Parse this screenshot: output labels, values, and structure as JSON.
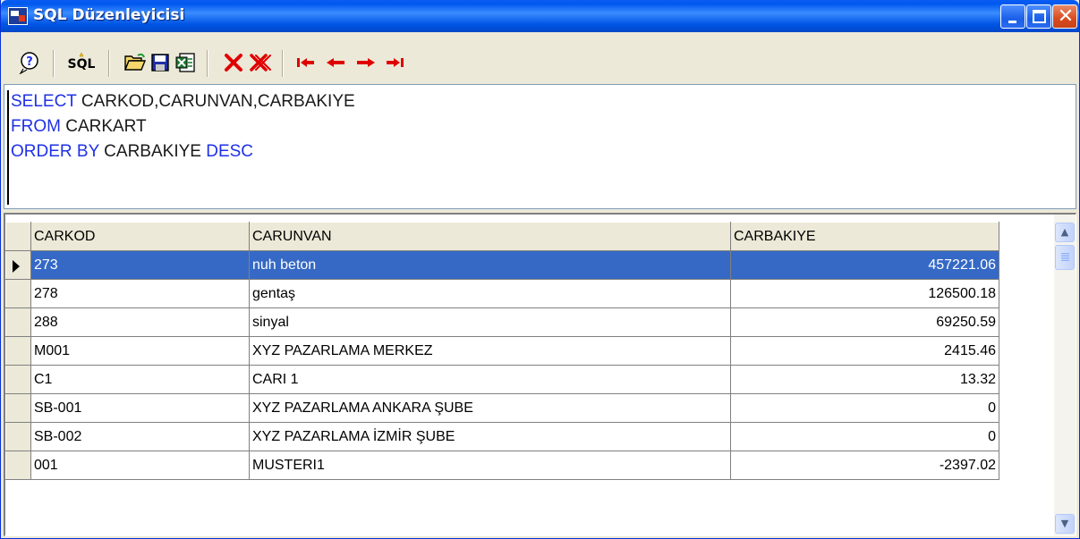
{
  "window": {
    "title": "SQL Düzenleyicisi",
    "close_glyph": "✕"
  },
  "toolbar": {
    "sql_label": "SQL"
  },
  "editor": {
    "line1_kw": "SELECT",
    "line1_text": " CARKOD,CARUNVAN,CARBAKIYE",
    "line2_kw": "FROM",
    "line2_text": " CARKART",
    "line3_kw1": "ORDER BY",
    "line3_text": " CARBAKIYE ",
    "line3_kw2": "DESC"
  },
  "grid": {
    "columns": [
      "CARKOD",
      "CARUNVAN",
      "CARBAKIYE"
    ],
    "rows": [
      [
        "273",
        "nuh beton",
        "457221.06"
      ],
      [
        "278",
        "gentaş",
        "126500.18"
      ],
      [
        "288",
        "sinyal",
        "69250.59"
      ],
      [
        "M001",
        "XYZ PAZARLAMA MERKEZ",
        "2415.46"
      ],
      [
        "C1",
        "CARI 1",
        "13.32"
      ],
      [
        "SB-001",
        "XYZ PAZARLAMA ANKARA ŞUBE",
        "0"
      ],
      [
        "SB-002",
        "XYZ PAZARLAMA İZMİR ŞUBE",
        "0"
      ],
      [
        "001",
        "MUSTERI1",
        "-2397.02"
      ]
    ],
    "selected_row": 0
  },
  "colors": {
    "keyword": "#1F31E6",
    "selection": "#3569C5"
  }
}
